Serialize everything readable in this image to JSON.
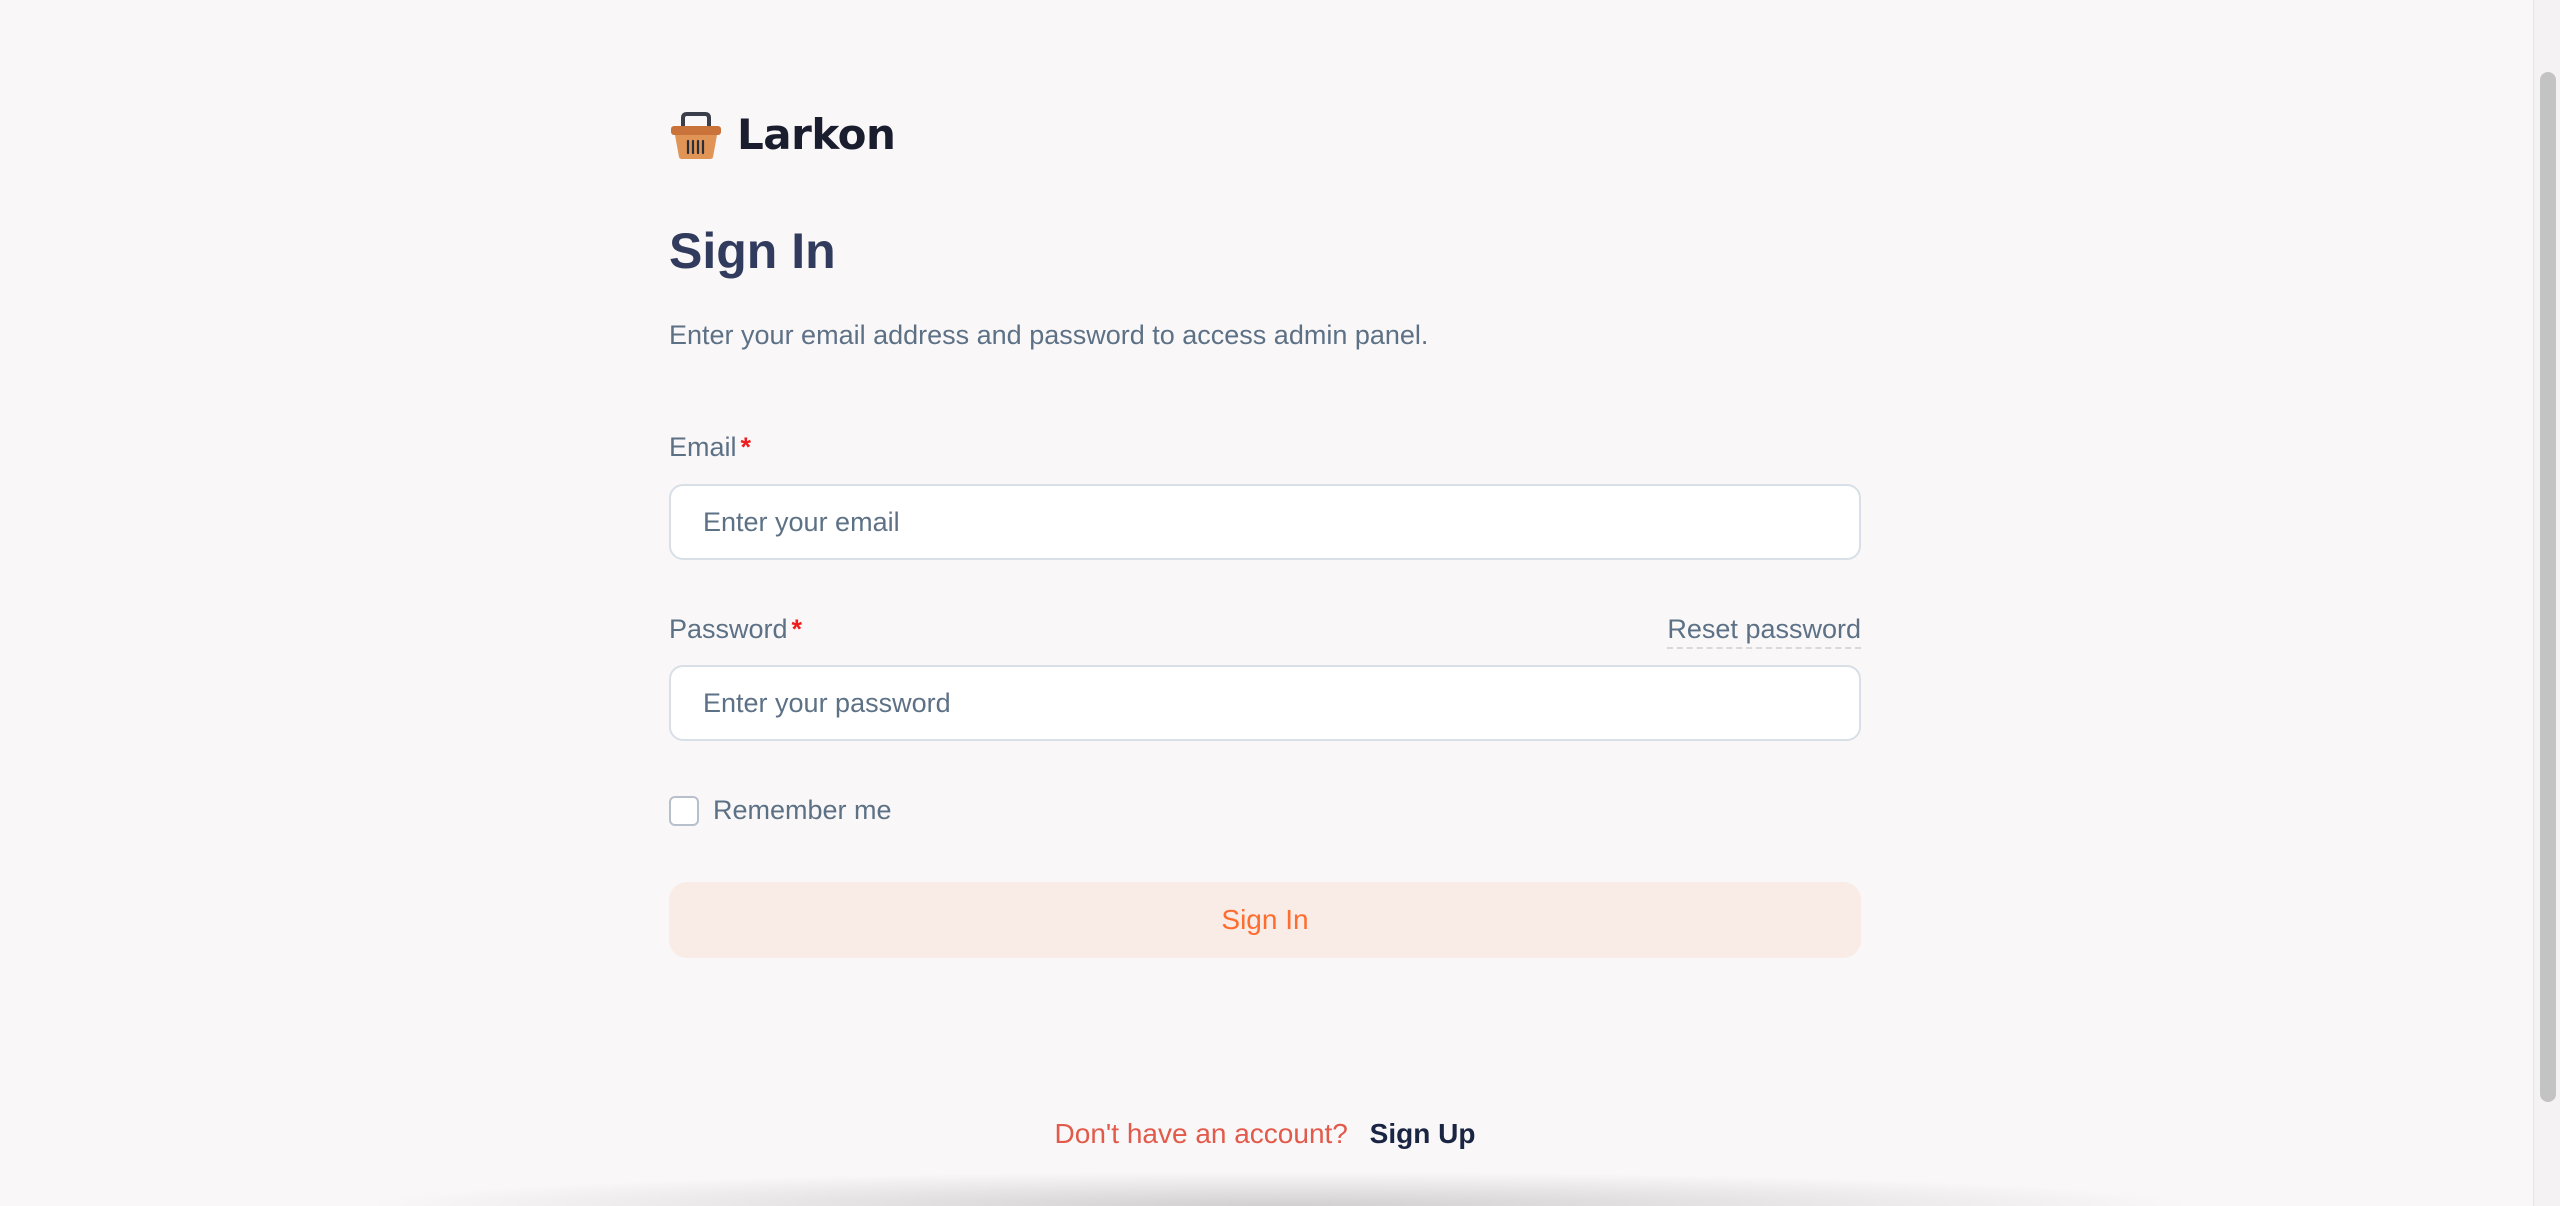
{
  "brand": {
    "name": "Larkon",
    "icon": "basket-icon",
    "accent": "#ff6c2f"
  },
  "header": {
    "title": "Sign In",
    "subtitle": "Enter your email address and password to access admin panel."
  },
  "form": {
    "email": {
      "label": "Email",
      "required_mark": "*",
      "placeholder": "Enter your email",
      "value": ""
    },
    "password": {
      "label": "Password",
      "required_mark": "*",
      "placeholder": "Enter your password",
      "value": "",
      "reset_link": "Reset password"
    },
    "remember": {
      "label": "Remember me",
      "checked": false
    },
    "submit_label": "Sign In"
  },
  "footer": {
    "question": "Don't have an account?",
    "signup_link": "Sign Up"
  },
  "colors": {
    "background": "#f9f7f7",
    "title": "#313b5e",
    "text": "#5d7186",
    "required": "#ef1d1d",
    "button_bg": "#f9ebe6",
    "button_text": "#ff6c2f",
    "footer_question": "#e15a4b"
  }
}
